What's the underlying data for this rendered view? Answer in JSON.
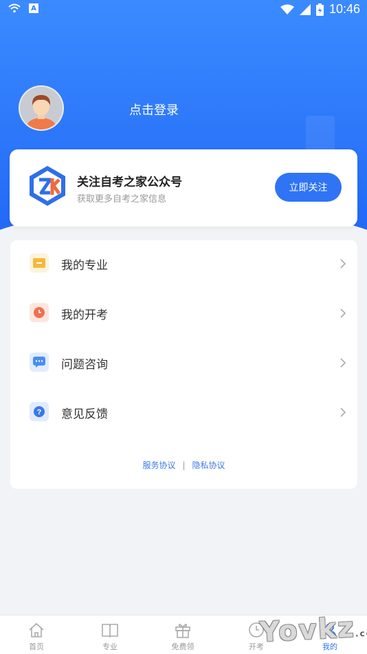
{
  "status_bar": {
    "time": "10:46",
    "icons": [
      "wifi-icon",
      "a-notification-icon",
      "wifi-signal-icon",
      "cell-signal-icon",
      "battery-icon"
    ]
  },
  "profile": {
    "login_prompt": "点击登录",
    "avatar_icon": "user-avatar"
  },
  "follow_card": {
    "title": "关注自考之家公众号",
    "subtitle": "获取更多自考之家信息",
    "button_label": "立即关注",
    "logo_icon": "zikao-logo-icon"
  },
  "menu": {
    "items": [
      {
        "label": "我的专业",
        "icon": "folder-icon",
        "color": "#f5b93a"
      },
      {
        "label": "我的开考",
        "icon": "clock-icon",
        "color": "#f0704f"
      },
      {
        "label": "问题咨询",
        "icon": "chat-icon",
        "color": "#4a8ef0"
      },
      {
        "label": "意见反馈",
        "icon": "question-icon",
        "color": "#3a78e8"
      }
    ],
    "links": {
      "service": "服务协议",
      "separator": "|",
      "privacy": "隐私协议"
    }
  },
  "tabbar": {
    "tabs": [
      {
        "label": "首页",
        "icon": "home-icon"
      },
      {
        "label": "专业",
        "icon": "book-icon"
      },
      {
        "label": "免费领",
        "icon": "gift-icon"
      },
      {
        "label": "开考",
        "icon": "clock-icon"
      },
      {
        "label": "我的",
        "icon": "user-icon",
        "active": true
      }
    ]
  },
  "watermark": {
    "text": "Yovkz",
    "suffix": ".com"
  },
  "colors": {
    "primary": "#2f74f5",
    "background": "#f2f3f7"
  }
}
